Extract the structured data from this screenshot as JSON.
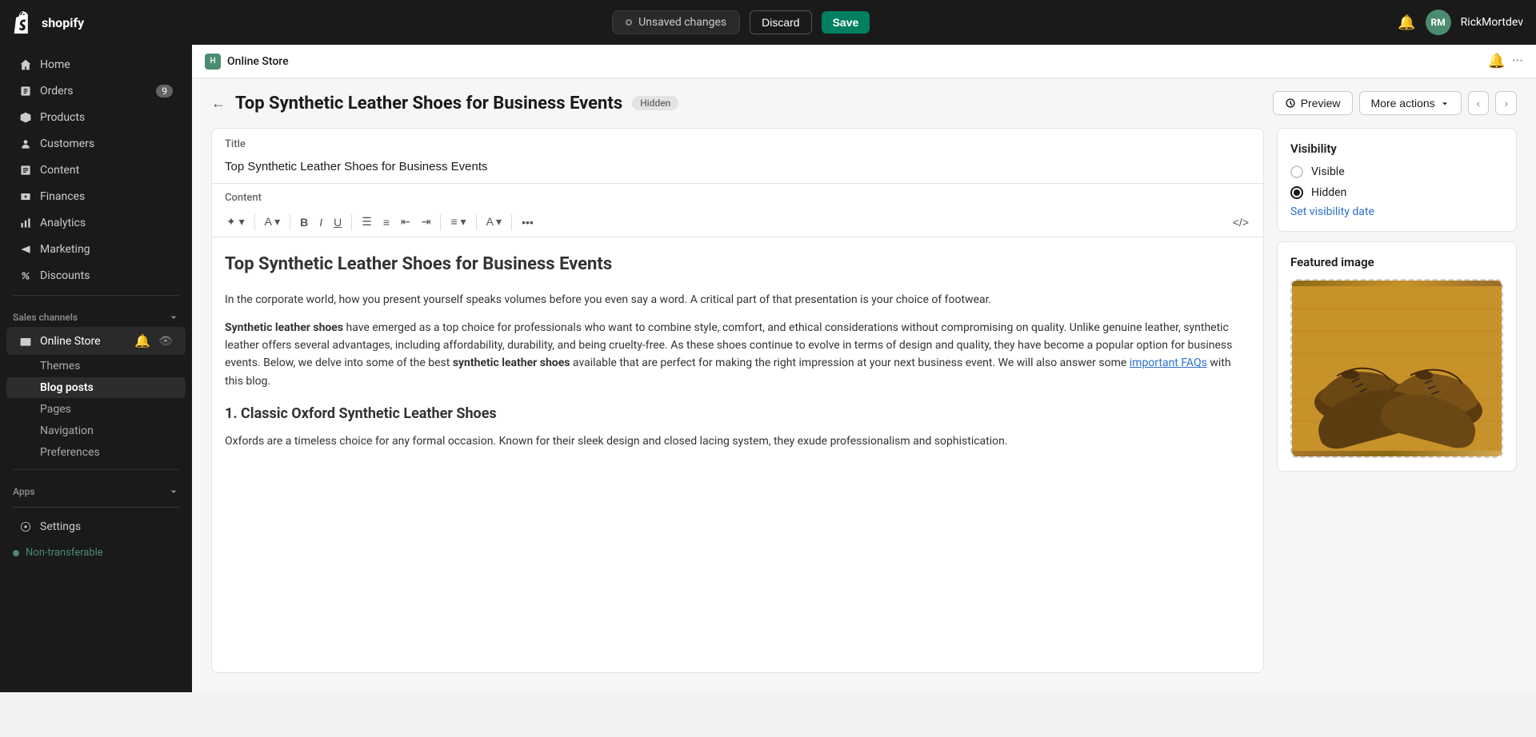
{
  "topnav": {
    "brand": "shopify",
    "unsaved_label": "Unsaved changes",
    "discard_label": "Discard",
    "save_label": "Save",
    "username": "RickMortdev"
  },
  "sidebar": {
    "items": [
      {
        "id": "home",
        "label": "Home",
        "icon": "home"
      },
      {
        "id": "orders",
        "label": "Orders",
        "icon": "orders",
        "badge": "9"
      },
      {
        "id": "products",
        "label": "Products",
        "icon": "products"
      },
      {
        "id": "customers",
        "label": "Customers",
        "icon": "customers"
      },
      {
        "id": "content",
        "label": "Content",
        "icon": "content"
      },
      {
        "id": "finances",
        "label": "Finances",
        "icon": "finances"
      },
      {
        "id": "analytics",
        "label": "Analytics",
        "icon": "analytics"
      },
      {
        "id": "marketing",
        "label": "Marketing",
        "icon": "marketing"
      },
      {
        "id": "discounts",
        "label": "Discounts",
        "icon": "discounts"
      }
    ],
    "sales_channels_label": "Sales channels",
    "online_store_label": "Online Store",
    "sub_items": [
      {
        "id": "themes",
        "label": "Themes"
      },
      {
        "id": "blog-posts",
        "label": "Blog posts",
        "active": true
      },
      {
        "id": "pages",
        "label": "Pages"
      },
      {
        "id": "navigation",
        "label": "Navigation"
      },
      {
        "id": "preferences",
        "label": "Preferences"
      }
    ],
    "apps_label": "Apps",
    "settings_label": "Settings",
    "non_transferable_label": "Non-transferable"
  },
  "sub_header": {
    "store_name": "Online Store"
  },
  "page": {
    "back_label": "←",
    "title": "Top Synthetic Leather Shoes for Business Events",
    "status_badge": "Hidden",
    "preview_label": "Preview",
    "more_actions_label": "More actions",
    "title_field_label": "Title",
    "title_value": "Top Synthetic Leather Shoes for Business Events",
    "content_field_label": "Content"
  },
  "editor": {
    "heading": "Top Synthetic Leather Shoes for Business Events",
    "para1": "In the corporate world, how you present yourself speaks volumes before you even say a word. A critical part of that presentation is your choice of footwear.",
    "bold_text": "Synthetic leather shoes",
    "para2_after": " have emerged as a top choice for professionals who want to combine style, comfort, and ethical considerations without compromising on quality. Unlike genuine leather, synthetic leather offers several advantages, including affordability, durability, and being cruelty-free. As these shoes continue to evolve in terms of design and quality, they have become a popular option for business events. Below, we delve into some of the best ",
    "bold_text2": "synthetic leather shoes",
    "para2_end": " available that are perfect for making the right impression at your next business event. We will also answer some ",
    "link_text": "important FAQs",
    "para2_final": " with this blog.",
    "subheading": "1. Classic Oxford Synthetic Leather Shoes",
    "para3": "Oxfords are a timeless choice for any formal occasion. Known for their sleek design and closed lacing system, they exude professionalism and sophistication."
  },
  "visibility": {
    "title": "Visibility",
    "visible_label": "Visible",
    "hidden_label": "Hidden",
    "set_date_label": "Set visibility date"
  },
  "featured_image": {
    "title": "Featured image"
  }
}
